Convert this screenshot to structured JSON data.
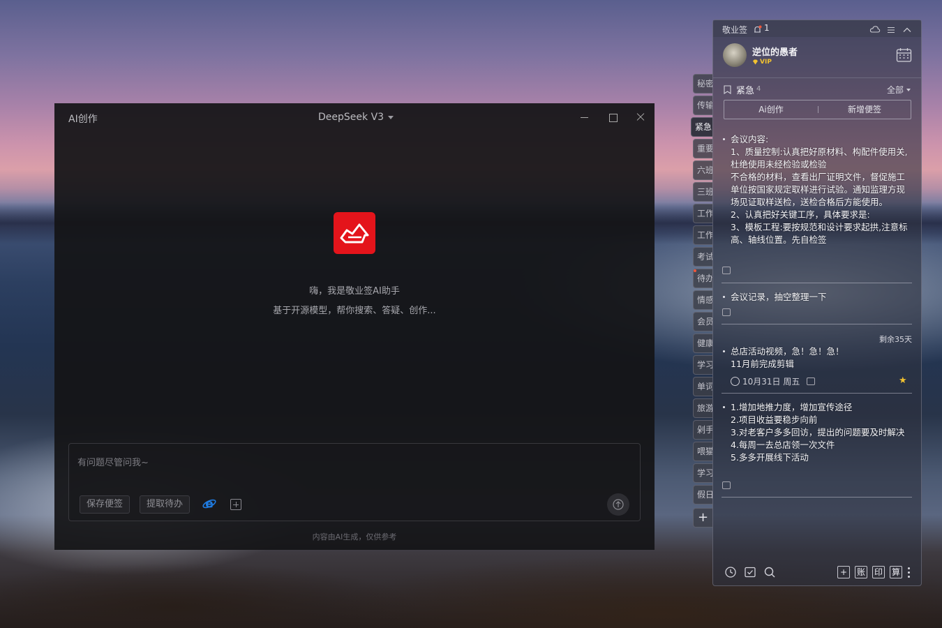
{
  "ai_window": {
    "title": "AI创作",
    "model": "DeepSeek V3",
    "greeting": "嗨，我是敬业签AI助手",
    "subtitle": "基于开源模型，帮你搜索、答疑、创作...",
    "input_placeholder": "有问题尽管问我~",
    "input_value": "",
    "save_note_label": "保存便签",
    "extract_todo_label": "提取待办",
    "disclaimer": "内容由AI生成，仅供参考"
  },
  "side_tabs": [
    "秘密",
    "传输",
    "紧急",
    "重要",
    "六班",
    "三班",
    "工作",
    "工作",
    "考试",
    "待办",
    "情感",
    "会员",
    "健康",
    "学习",
    "单词",
    "旅游",
    "剁手",
    "喂猫",
    "学习",
    "假日"
  ],
  "side_tabs_active": 2,
  "notes_panel": {
    "app_name": "敬业签",
    "bell_count": "1",
    "user_name": "逆位的愚者",
    "vip_label": "VIP",
    "category": "紧急",
    "category_count": "4",
    "filter_label": "全部",
    "ai_create_label": "Ai创作",
    "new_note_label": "新增便签",
    "notes": [
      {
        "lines": [
          "会议内容:",
          "1、质量控制:认真把好原材料、构配件使用关,杜绝使用未经检验或检验",
          "不合格的材料，查看出厂证明文件，督促施工单位按国家规定取样进行试验。通知监理方现场见证取样送检，送检合格后方能使用。",
          "2、认真把好关键工序，具体要求是:",
          "3、模板工程:要按规范和设计要求起拱,注意标高、轴线位置。先自检签"
        ]
      },
      {
        "lines": [
          "会议记录，抽空整理一下"
        ]
      },
      {
        "remaining": "剩余35天",
        "lines": [
          "总店活动视频，急！急！急！",
          "11月前完成剪辑"
        ],
        "date": "10月31日 周五",
        "starred": true
      },
      {
        "lines": [
          "1.增加地推力度，增加宣传途径",
          "2.项目收益要稳步向前",
          "3.对老客户多多回访，提出的问题要及时解决",
          "4.每周一去总店领一次文件",
          "5.多多开展线下活动"
        ]
      }
    ],
    "toolbar_chars": [
      "账",
      "印",
      "算"
    ]
  },
  "colors": {
    "brand_red": "#e4141b",
    "vip_gold": "#f2c230",
    "ie_blue": "#1f7be0"
  }
}
